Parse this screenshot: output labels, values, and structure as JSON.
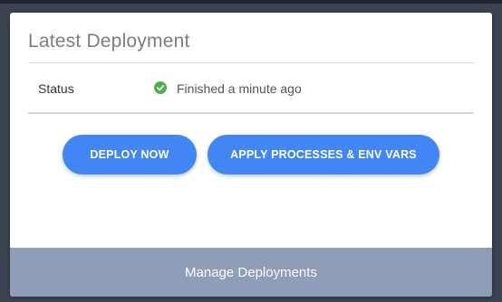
{
  "card": {
    "title": "Latest Deployment",
    "status_row": {
      "label": "Status",
      "icon": "check-circle-icon",
      "value": "Finished a minute ago",
      "status_color": "#4caf50"
    },
    "buttons": {
      "deploy_label": "DEPLOY NOW",
      "apply_label": "APPLY PROCESSES & ENV VARS",
      "color": "#4285f4"
    },
    "footer": {
      "label": "Manage Deployments",
      "color": "#8f9db8"
    }
  }
}
